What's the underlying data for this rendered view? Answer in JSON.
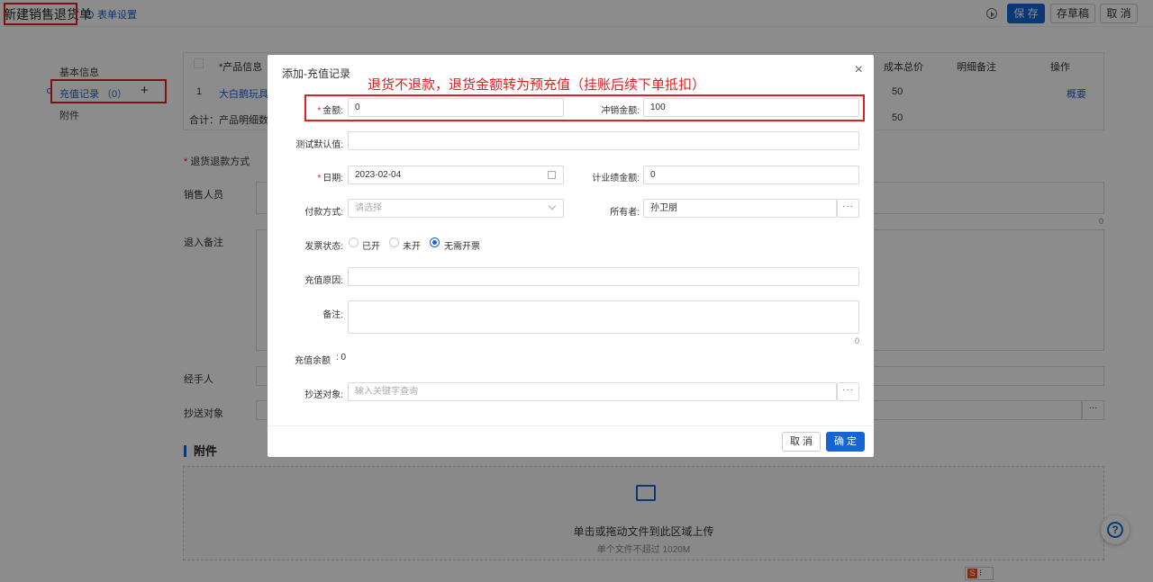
{
  "header": {
    "title": "新建销售退货单",
    "form_settings": "表单设置",
    "save": "保 存",
    "save_draft": "存草稿",
    "cancel": "取 消"
  },
  "sidebar": {
    "items": [
      {
        "label": "基本信息"
      },
      {
        "label": "充值记录 （0）"
      },
      {
        "label": "附件"
      }
    ]
  },
  "product_table": {
    "headers": [
      "*产品信息",
      "成本总价",
      "明细备注",
      "操作"
    ],
    "rows": [
      {
        "index": "1",
        "product": "大白鹅玩具",
        "cost": "50",
        "action": "概要"
      }
    ],
    "summary_label": "合计：产品明细数1",
    "summary_cost": "50"
  },
  "background_form": {
    "refund_method": "退货退款方式",
    "sales_person": "销售人员",
    "return_note": "退入备注",
    "note_counter": "0",
    "handler": "经手人",
    "cc": "抄送对象"
  },
  "attachments": {
    "title": "附件",
    "upload_text": "单击或拖动文件到此区域上传",
    "upload_hint": "单个文件不超过 1020M"
  },
  "modal": {
    "title": "添加-充值记录",
    "annotation": "退货不退款，退货金额转为预充值（挂账后续下单抵扣）",
    "fields": {
      "amount_label": "金额:",
      "amount_value": "0",
      "offset_label": "冲销金额:",
      "offset_value": "100",
      "test_default_label": "测试默认值:",
      "test_default_value": "",
      "date_label": "日期:",
      "date_value": "2023-02-04",
      "performance_label": "计业绩金额:",
      "performance_value": "0",
      "payment_label": "付款方式:",
      "payment_placeholder": "请选择",
      "owner_label": "所有者:",
      "owner_value": "孙卫朋",
      "invoice_label": "发票状态:",
      "invoice_options": [
        "已开",
        "未开",
        "无需开票"
      ],
      "invoice_selected": "无需开票",
      "reason_label": "充值原因:",
      "remark_label": "备注:",
      "remark_counter": "0",
      "balance_label": "充值余额",
      "balance_value": ": 0",
      "cc_label": "抄送对象:",
      "cc_placeholder": "输入关键字查询"
    },
    "cancel": "取 消",
    "confirm": "确 定"
  },
  "colors": {
    "primary": "#1664d6",
    "annotation_red": "#e02020"
  }
}
